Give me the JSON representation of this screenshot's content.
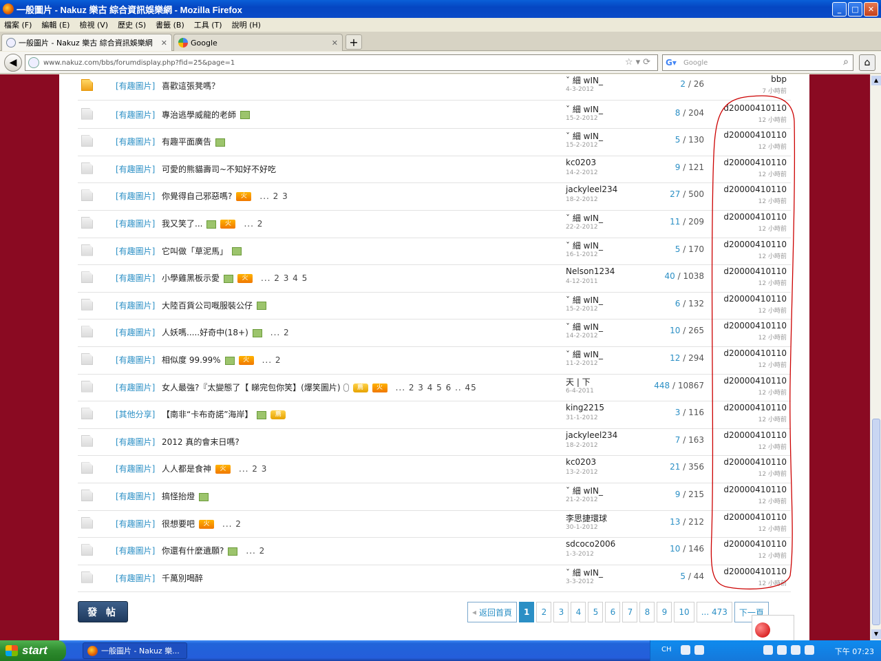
{
  "window": {
    "title": "一般圖片 - Nakuz 樂古 綜合資訊娛樂網 - Mozilla Firefox"
  },
  "menu": [
    "檔案 (F)",
    "編輯 (E)",
    "檢視 (V)",
    "歷史 (S)",
    "書籤 (B)",
    "工具 (T)",
    "說明 (H)"
  ],
  "tabs": [
    {
      "label": "一般圖片 - Nakuz 樂古 綜合資訊娛樂網"
    },
    {
      "label": "Google"
    }
  ],
  "nav": {
    "url": "www.nakuz.com/bbs/forumdisplay.php?fid=25&page=1",
    "search_placeholder": "Google"
  },
  "rows": [
    {
      "tag": "[有趣圖片]",
      "subject": "喜歡這張凳嗎？",
      "img": false,
      "hot": false,
      "jian": false,
      "clip": false,
      "pages": "",
      "author": "ˇ 細 wIN_",
      "adate": "4-3-2012",
      "replies": "2",
      "views": "26",
      "last": "bbp",
      "ltime": "7 小時前",
      "hot_icon": true
    },
    {
      "tag": "[有趣圖片]",
      "subject": "專治逃學威龍的老師",
      "img": true,
      "hot": false,
      "jian": false,
      "clip": false,
      "pages": "",
      "author": "ˇ 細 wIN_",
      "adate": "15-2-2012",
      "replies": "8",
      "views": "204",
      "last": "d20000410110",
      "ltime": "12 小時前"
    },
    {
      "tag": "[有趣圖片]",
      "subject": "有趣平面廣告",
      "img": true,
      "hot": false,
      "jian": false,
      "clip": false,
      "pages": "",
      "author": "ˇ 細 wIN_",
      "adate": "15-2-2012",
      "replies": "5",
      "views": "130",
      "last": "d20000410110",
      "ltime": "12 小時前"
    },
    {
      "tag": "[有趣圖片]",
      "subject": "可愛的熊貓壽司~不知好不好吃",
      "img": false,
      "hot": false,
      "jian": false,
      "clip": false,
      "pages": "",
      "author": "kc0203",
      "adate": "14-2-2012",
      "replies": "9",
      "views": "121",
      "last": "d20000410110",
      "ltime": "12 小時前"
    },
    {
      "tag": "[有趣圖片]",
      "subject": "你覺得自己邪惡嗎?",
      "img": false,
      "hot": true,
      "jian": false,
      "clip": false,
      "pages": "... 2 3",
      "author": "jackyleel234",
      "adate": "18-2-2012",
      "replies": "27",
      "views": "500",
      "last": "d20000410110",
      "ltime": "12 小時前"
    },
    {
      "tag": "[有趣圖片]",
      "subject": "我又笑了...",
      "img": true,
      "hot": true,
      "jian": false,
      "clip": false,
      "pages": "... 2",
      "author": "ˇ 細 wIN_",
      "adate": "22-2-2012",
      "replies": "11",
      "views": "209",
      "last": "d20000410110",
      "ltime": "12 小時前"
    },
    {
      "tag": "[有趣圖片]",
      "subject": "它叫做「草泥馬」",
      "img": true,
      "hot": false,
      "jian": false,
      "clip": false,
      "pages": "",
      "author": "ˇ 細 wIN_",
      "adate": "16-1-2012",
      "replies": "5",
      "views": "170",
      "last": "d20000410110",
      "ltime": "12 小時前"
    },
    {
      "tag": "[有趣圖片]",
      "subject": "小學雞黑板示愛",
      "img": true,
      "hot": true,
      "jian": false,
      "clip": false,
      "pages": "... 2 3 4 5",
      "author": "Nelson1234",
      "adate": "4-12-2011",
      "replies": "40",
      "views": "1038",
      "last": "d20000410110",
      "ltime": "12 小時前"
    },
    {
      "tag": "[有趣圖片]",
      "subject": "大陸百貨公司嘅服裝公仔",
      "img": true,
      "hot": false,
      "jian": false,
      "clip": false,
      "pages": "",
      "author": "ˇ 細 wIN_",
      "adate": "15-2-2012",
      "replies": "6",
      "views": "132",
      "last": "d20000410110",
      "ltime": "12 小時前"
    },
    {
      "tag": "[有趣圖片]",
      "subject": "人妖嗎.....好奇中(18+)",
      "img": true,
      "hot": false,
      "jian": false,
      "clip": false,
      "pages": "... 2",
      "author": "ˇ 細 wIN_",
      "adate": "14-2-2012",
      "replies": "10",
      "views": "265",
      "last": "d20000410110",
      "ltime": "12 小時前"
    },
    {
      "tag": "[有趣圖片]",
      "subject": "相似度 99.99%",
      "img": true,
      "hot": true,
      "jian": false,
      "clip": false,
      "pages": "... 2",
      "author": "ˇ 細 wIN_",
      "adate": "11-2-2012",
      "replies": "12",
      "views": "294",
      "last": "d20000410110",
      "ltime": "12 小時前"
    },
    {
      "tag": "[有趣圖片]",
      "subject": "女人最強?『太變態了【 睇完包你笑】(爆笑圖片)",
      "img": false,
      "hot": true,
      "jian": true,
      "clip": true,
      "pages": "... 2 3 4 5 6 .. 45",
      "author": "天 | 下",
      "adate": "6-4-2011",
      "replies": "448",
      "views": "10867",
      "last": "d20000410110",
      "ltime": "12 小時前"
    },
    {
      "tag": "[其他分享]",
      "subject": "【南非“卡布奇諾”海岸】",
      "img": true,
      "hot": false,
      "jian": true,
      "clip": false,
      "pages": "",
      "author": "king2215",
      "adate": "31-1-2012",
      "replies": "3",
      "views": "116",
      "last": "d20000410110",
      "ltime": "12 小時前"
    },
    {
      "tag": "[有趣圖片]",
      "subject": "2012 真的會末日嗎?",
      "img": false,
      "hot": false,
      "jian": false,
      "clip": false,
      "pages": "",
      "author": "jackyleel234",
      "adate": "18-2-2012",
      "replies": "7",
      "views": "163",
      "last": "d20000410110",
      "ltime": "12 小時前"
    },
    {
      "tag": "[有趣圖片]",
      "subject": "人人都是食神",
      "img": false,
      "hot": true,
      "jian": false,
      "clip": false,
      "pages": "... 2 3",
      "author": "kc0203",
      "adate": "13-2-2012",
      "replies": "21",
      "views": "356",
      "last": "d20000410110",
      "ltime": "12 小時前"
    },
    {
      "tag": "[有趣圖片]",
      "subject": "搞怪抬燈",
      "img": true,
      "hot": false,
      "jian": false,
      "clip": false,
      "pages": "",
      "author": "ˇ 細 wIN_",
      "adate": "21-2-2012",
      "replies": "9",
      "views": "215",
      "last": "d20000410110",
      "ltime": "12 小時前"
    },
    {
      "tag": "[有趣圖片]",
      "subject": "很想要吧",
      "img": false,
      "hot": true,
      "jian": false,
      "clip": false,
      "pages": "... 2",
      "author": "李思捷環球",
      "adate": "30-1-2012",
      "replies": "13",
      "views": "212",
      "last": "d20000410110",
      "ltime": "12 小時前"
    },
    {
      "tag": "[有趣圖片]",
      "subject": "你還有什麼遺願?",
      "img": true,
      "hot": false,
      "jian": false,
      "clip": false,
      "pages": "... 2",
      "author": "sdcoco2006",
      "adate": "1-3-2012",
      "replies": "10",
      "views": "146",
      "last": "d20000410110",
      "ltime": "12 小時前"
    },
    {
      "tag": "[有趣圖片]",
      "subject": "千萬別喝醉",
      "img": false,
      "hot": false,
      "jian": false,
      "clip": false,
      "pages": "",
      "author": "ˇ 細 wIN_",
      "adate": "3-3-2012",
      "replies": "5",
      "views": "44",
      "last": "d20000410110",
      "ltime": "12 小時前"
    }
  ],
  "post_button": "發 帖",
  "pager": {
    "home": "返回首頁",
    "pages": [
      "1",
      "2",
      "3",
      "4",
      "5",
      "6",
      "7",
      "8",
      "9",
      "10",
      "... 473"
    ],
    "current": "1",
    "next": "下一頁"
  },
  "taskbar": {
    "start": "start",
    "item": "一般圖片 - Nakuz 樂...",
    "lang": "CH",
    "time": "下午 07:23"
  },
  "colors": {
    "accent": "#2b8fc5",
    "page_bg": "#8a0a22",
    "annotation": "#cc0000"
  }
}
